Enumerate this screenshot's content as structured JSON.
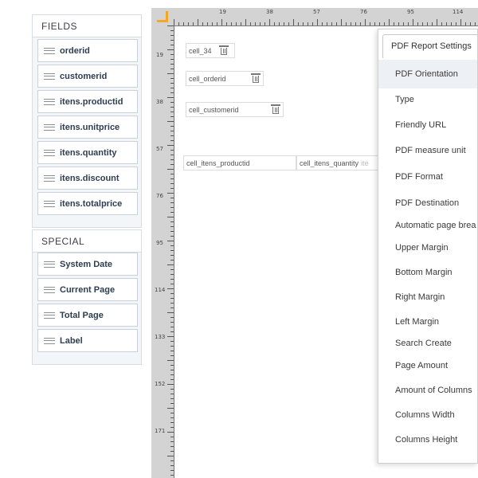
{
  "fields_panel": {
    "title": "FIELDS",
    "items": [
      {
        "label": "orderid"
      },
      {
        "label": "customerid"
      },
      {
        "label": "itens.productid"
      },
      {
        "label": "itens.unitprice"
      },
      {
        "label": "itens.quantity"
      },
      {
        "label": "itens.discount"
      },
      {
        "label": "itens.totalprice"
      }
    ]
  },
  "special_panel": {
    "title": "SPECIAL",
    "items": [
      {
        "label": "System Date"
      },
      {
        "label": "Current Page"
      },
      {
        "label": "Total Page"
      },
      {
        "label": "Label"
      }
    ]
  },
  "rulers": {
    "top": [
      "19",
      "38",
      "57",
      "76",
      "95",
      "114"
    ],
    "left": [
      "19",
      "38",
      "57",
      "76",
      "95",
      "114",
      "133",
      "152",
      "171"
    ]
  },
  "cells": {
    "cell_34": "cell_34",
    "cell_orderid": "cell_orderid",
    "cell_customerid": "cell_customerid",
    "cell_itens_productid": "cell_itens_productid",
    "cell_itens_quantity": "cell_itens_quantity",
    "cell_itens_trailing": "ite"
  },
  "settings_panel": {
    "tab_label": "PDF Report Settings",
    "items": [
      {
        "label": "PDF Orientation"
      },
      {
        "label": "Type"
      },
      {
        "label": "Friendly URL"
      },
      {
        "label": "PDF measure unit"
      },
      {
        "label": "PDF Format"
      },
      {
        "label": "PDF Destination"
      },
      {
        "label": "Automatic page brea"
      },
      {
        "label": "Upper Margin"
      },
      {
        "label": "Bottom Margin"
      },
      {
        "label": "Right Margin"
      },
      {
        "label": "Left Margin"
      },
      {
        "label": "Search Create"
      },
      {
        "label": "Page Amount"
      },
      {
        "label": "Amount of Columns"
      },
      {
        "label": "Columns Width"
      },
      {
        "label": "Columns Height"
      }
    ]
  },
  "colors": {
    "accent_corner": "#f5a623",
    "panel_bg": "#f3f6f9",
    "ruler_bg": "#d3d3d3"
  }
}
